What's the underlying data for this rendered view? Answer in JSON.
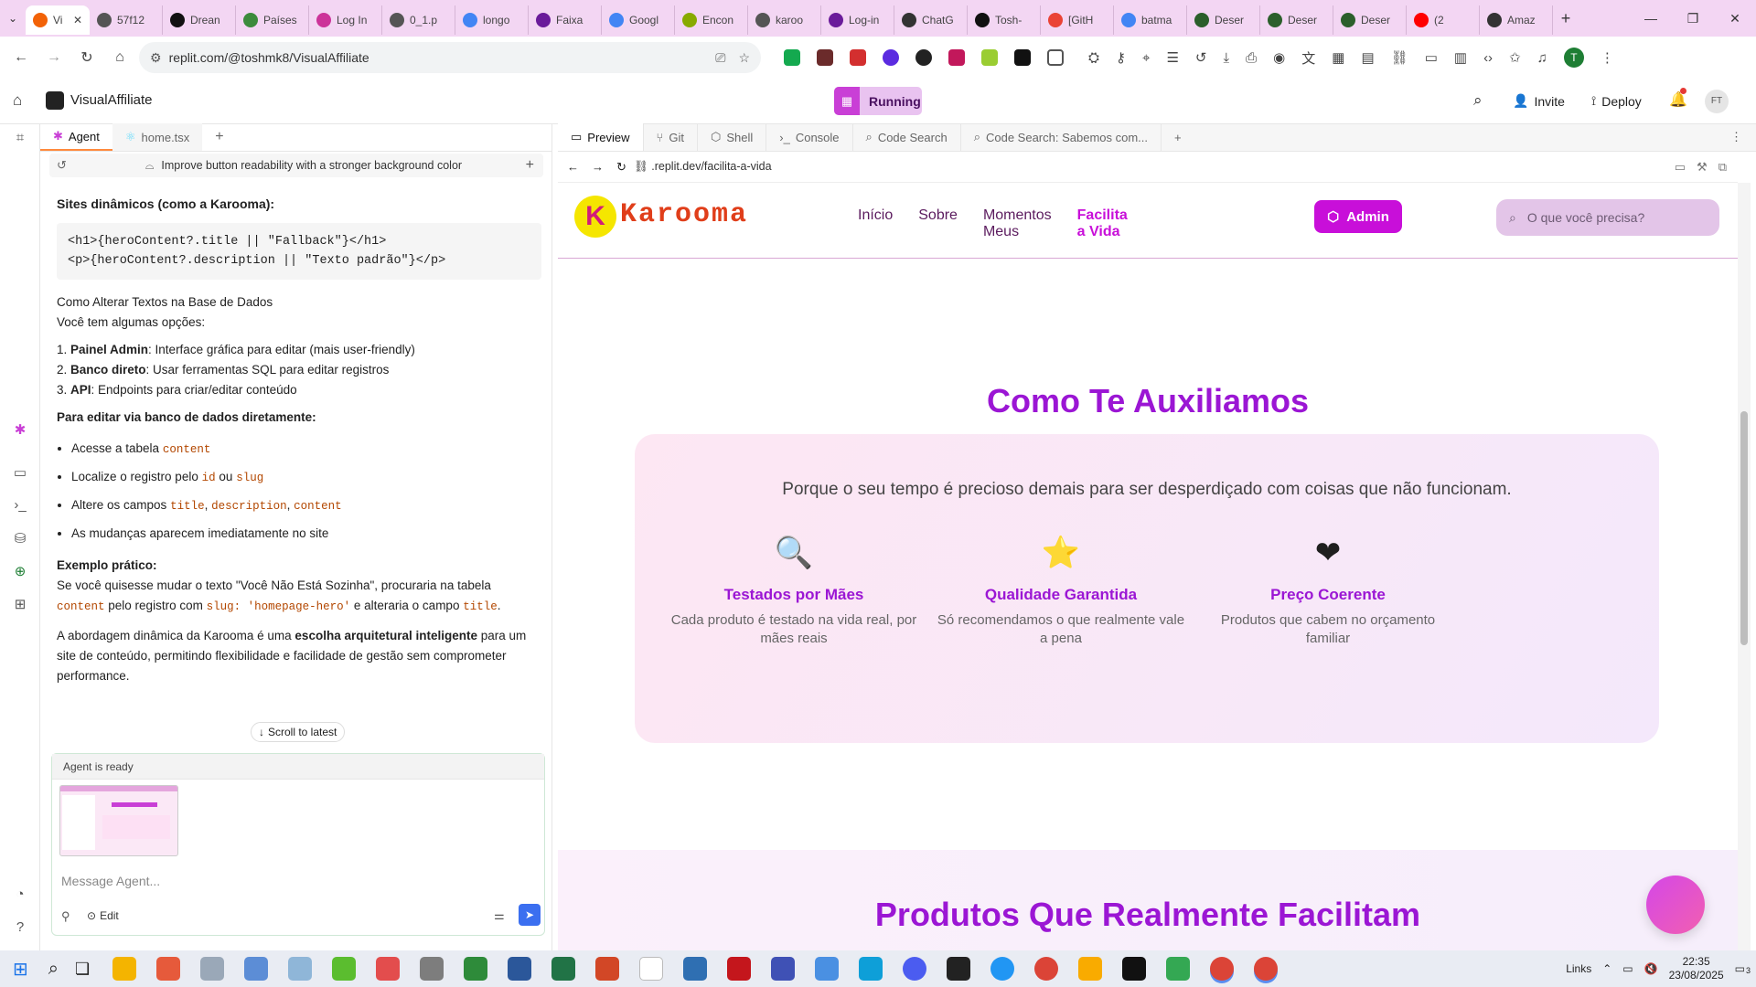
{
  "browser": {
    "tabs": [
      {
        "label": "Vi",
        "color": "#f26207",
        "active": true
      },
      {
        "label": "57f12",
        "color": "#555555"
      },
      {
        "label": "Drean",
        "color": "#111111"
      },
      {
        "label": "Países",
        "color": "#3c8b3c"
      },
      {
        "label": "Log In",
        "color": "#cc3399"
      },
      {
        "label": "0_1.p",
        "color": "#555555"
      },
      {
        "label": "longo",
        "color": "#4285f4"
      },
      {
        "label": "Faixa",
        "color": "#6a1b9a"
      },
      {
        "label": "Googl",
        "color": "#4285f4"
      },
      {
        "label": "Encon",
        "color": "#88aa00"
      },
      {
        "label": "karoo",
        "color": "#555555"
      },
      {
        "label": "Log-in",
        "color": "#6a1b9a"
      },
      {
        "label": "ChatG",
        "color": "#333333"
      },
      {
        "label": "Tosh-",
        "color": "#111111"
      },
      {
        "label": "[GitH",
        "color": "#ea4335"
      },
      {
        "label": "batma",
        "color": "#4285f4"
      },
      {
        "label": "Deser",
        "color": "#2b5f2b"
      },
      {
        "label": "Deser",
        "color": "#2b5f2b"
      },
      {
        "label": "Deser",
        "color": "#2b5f2b"
      },
      {
        "label": "(2",
        "color": "#ff0000"
      },
      {
        "label": "Amaz",
        "color": "#333333"
      }
    ],
    "url": "replit.com/@toshmk8/VisualAffiliate",
    "profile_initial": "T"
  },
  "replit": {
    "project_name": "VisualAffiliate",
    "run_status": "Running",
    "invite_label": "Invite",
    "deploy_label": "Deploy",
    "avatar_initials": "FT",
    "left_tabs": {
      "agent": "Agent",
      "file": "home.tsx"
    },
    "right_tabs": [
      "Preview",
      "Git",
      "Shell",
      "Console",
      "Code Search",
      "Code Search: Sabemos com..."
    ],
    "preview_url": ".replit.dev/facilita-a-vida"
  },
  "agent": {
    "checkpoint": "Improve button readability with a stronger background color",
    "dynamic_heading": "Sites dinâmicos (como a Karooma):",
    "code_line1": "<h1>{heroContent?.title || \"Fallback\"}</h1>",
    "code_line2": "<p>{heroContent?.description || \"Texto padrão\"}</p>",
    "alter_title": "Como Alterar Textos na Base de Dados",
    "alter_sub": "Você tem algumas opções:",
    "options": [
      {
        "n": "1.",
        "bold": "Painel Admin",
        "rest": ": Interface gráfica para editar (mais user-friendly)"
      },
      {
        "n": "2.",
        "bold": "Banco direto",
        "rest": ": Usar ferramentas SQL para editar registros"
      },
      {
        "n": "3.",
        "bold": "API",
        "rest": ": Endpoints para criar/editar conteúdo"
      }
    ],
    "db_heading": "Para editar via banco de dados diretamente:",
    "bullet1_text": "Acesse a tabela",
    "bullet1_code": "content",
    "bullet2_text": "Localize o registro pelo",
    "bullet2_code1": "id",
    "bullet2_mid": "ou",
    "bullet2_code2": "slug",
    "bullet3_text": "Altere os campos",
    "bullet3_code1": "title",
    "bullet3_code2": "description",
    "bullet3_code3": "content",
    "bullet4_text": "As mudanças aparecem imediatamente no site",
    "example_heading": "Exemplo prático:",
    "example_line1": "Se você quisesse mudar o texto \"Você Não Está Sozinha\", procuraria na tabela",
    "example_code1": "content",
    "example_mid": "pelo registro com",
    "example_code2": "slug: 'homepage-hero'",
    "example_mid2": "e alteraria o campo",
    "example_code3": "title",
    "closing_pre": "A abordagem dinâmica da Karooma é uma",
    "closing_bold": "escolha arquitetural inteligente",
    "closing_post": "para um site de conteúdo, permitindo flexibilidade e facilidade de gestão sem comprometer performance.",
    "scroll_latest": "Scroll to latest",
    "status": "Agent is ready",
    "input_placeholder": "Message Agent...",
    "edit_label": "Edit"
  },
  "site": {
    "logo_text": "Karooma",
    "nav": [
      "Início",
      "Sobre",
      "Momentos Meus",
      "Facilita a Vida"
    ],
    "nav_active_index": 3,
    "admin_label": "Admin",
    "search_placeholder": "O que você precisa?",
    "section_title": "Como Te Auxiliamos",
    "section_subtitle": "Porque o seu tempo é precioso demais para ser desperdiçado com coisas que não funcionam.",
    "features": [
      {
        "icon": "magnifier-icon",
        "glyph": "🔍",
        "title": "Testados por Mães",
        "text": "Cada produto é testado na vida real, por mães reais"
      },
      {
        "icon": "star-icon",
        "glyph": "⭐",
        "title": "Qualidade Garantida",
        "text": "Só recomendamos o que realmente vale a pena"
      },
      {
        "icon": "heart-icon",
        "glyph": "❤",
        "title": "Preço Coerente",
        "text": "Produtos que cabem no orçamento familiar"
      }
    ],
    "next_title": "Produtos Que Realmente Facilitam"
  },
  "taskbar": {
    "links": "Links",
    "time": "22:35",
    "date": "23/08/2025",
    "notif_count": "3"
  }
}
